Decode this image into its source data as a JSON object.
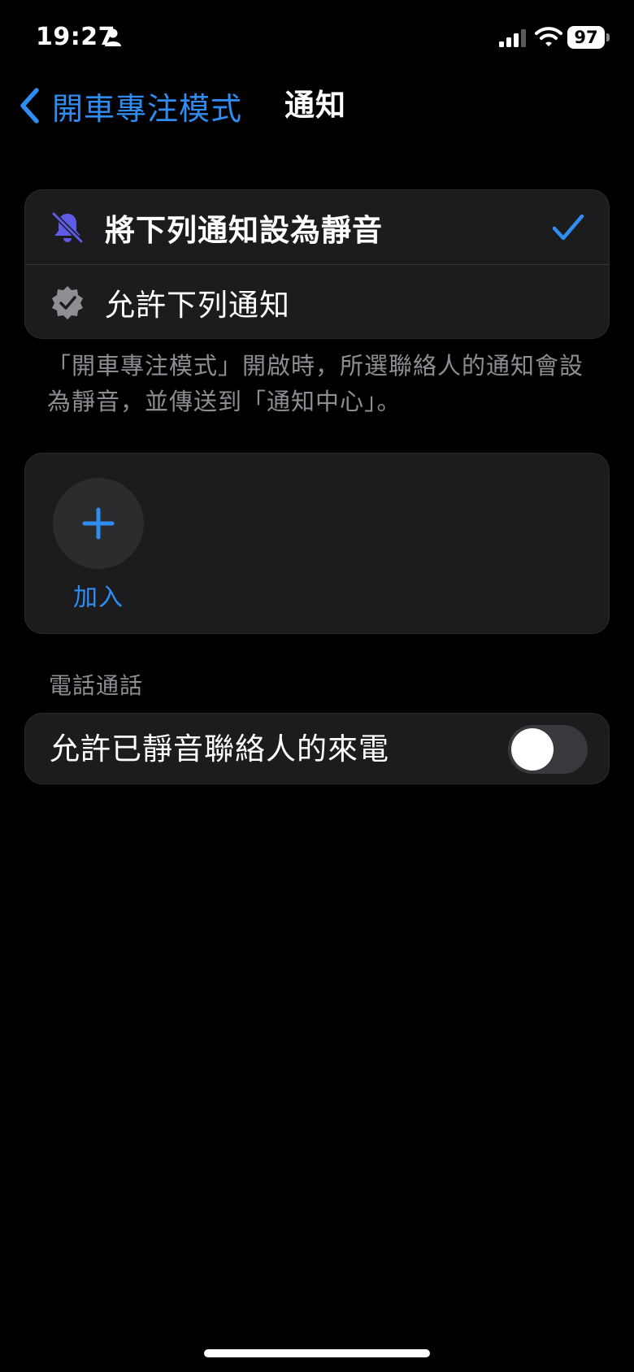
{
  "status_bar": {
    "time": "19:27",
    "battery": "97"
  },
  "nav": {
    "back_label": "開車專注模式",
    "title": "通知"
  },
  "mode_options": [
    {
      "label": "將下列通知設為靜音",
      "selected": true,
      "icon": "bell-slash-icon"
    },
    {
      "label": "允許下列通知",
      "selected": false,
      "icon": "checkmark-seal-icon"
    }
  ],
  "description": "「開車專注模式」開啟時，所選聯絡人的通知會設為靜音，並傳送到「通知中心」。",
  "contacts": {
    "add_label": "加入"
  },
  "calls_section": {
    "header": "電話通話",
    "toggle_label": "允許已靜音聯絡人的來電",
    "toggle_on": false
  },
  "colors": {
    "accent": "#2f8cf0",
    "bell_icon": "#5e5ce6",
    "card_bg": "#1c1c1e",
    "secondary_text": "#8d8d93"
  }
}
